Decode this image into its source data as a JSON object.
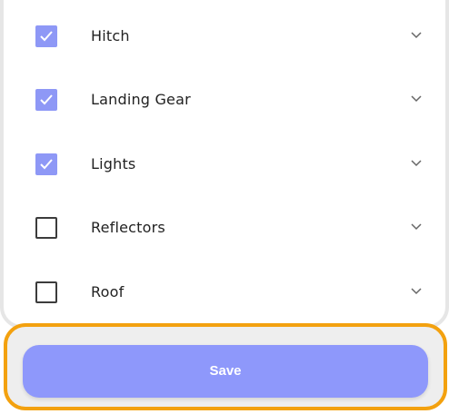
{
  "checklist": {
    "items": [
      {
        "label": "Hitch",
        "checked": true,
        "icon": "chevron-down-icon"
      },
      {
        "label": "Landing Gear",
        "checked": true,
        "icon": "chevron-down-icon"
      },
      {
        "label": "Lights",
        "checked": true,
        "icon": "chevron-down-icon"
      },
      {
        "label": "Reflectors",
        "checked": false,
        "icon": "chevron-down-icon"
      },
      {
        "label": "Roof",
        "checked": false,
        "icon": "chevron-down-icon"
      }
    ]
  },
  "actions": {
    "save_label": "Save"
  },
  "colors": {
    "accent": "#8e98fb",
    "checkbox_checked": "#8e98f6",
    "highlight_border": "#f3a10f",
    "text": "#222222"
  }
}
